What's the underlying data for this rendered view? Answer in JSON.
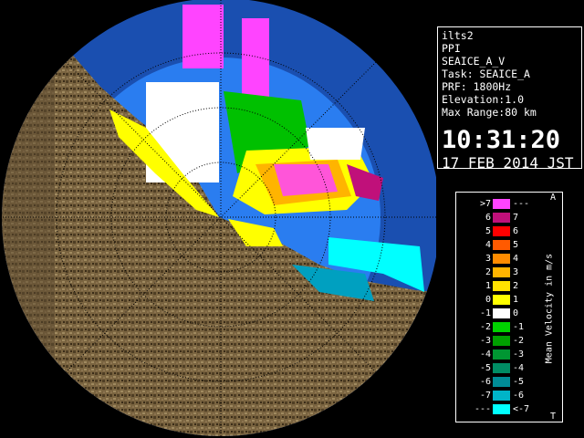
{
  "info": {
    "station": "ilts2",
    "product": "PPI",
    "task_name": "SEAICE_A_V",
    "task": "Task: SEAICE_A",
    "prf": "PRF: 1800Hz",
    "elevation": "Elevation:1.0",
    "max_range": "Max Range:80 km",
    "time": "10:31:20",
    "date": "17 FEB 2014 JST"
  },
  "legend": {
    "title": "Mean Velocity in m/s",
    "top_marker": "A",
    "bottom_marker": "T",
    "rows": [
      {
        "left": ">7",
        "right": "---",
        "color": "#ff44ff"
      },
      {
        "left": "6",
        "right": "7",
        "color": "#c0107a"
      },
      {
        "left": "5",
        "right": "6",
        "color": "#ff0000"
      },
      {
        "left": "4",
        "right": "5",
        "color": "#ff5a00"
      },
      {
        "left": "3",
        "right": "4",
        "color": "#ff8c00"
      },
      {
        "left": "2",
        "right": "3",
        "color": "#ffb400"
      },
      {
        "left": "1",
        "right": "2",
        "color": "#ffe100"
      },
      {
        "left": "0",
        "right": "1",
        "color": "#ffff00"
      },
      {
        "left": "-1",
        "right": "0",
        "color": "#ffffff"
      },
      {
        "left": "-2",
        "right": "-1",
        "color": "#00d200"
      },
      {
        "left": "-3",
        "right": "-2",
        "color": "#00a000"
      },
      {
        "left": "-4",
        "right": "-3",
        "color": "#009632"
      },
      {
        "left": "-5",
        "right": "-4",
        "color": "#008c64"
      },
      {
        "left": "-6",
        "right": "-5",
        "color": "#008c96"
      },
      {
        "left": "-7",
        "right": "-6",
        "color": "#00b4c8"
      },
      {
        "left": "---",
        "right": "<-7",
        "color": "#00ffff"
      }
    ]
  },
  "map": {
    "ocean_color": "#2a7df0",
    "outer_color": "#1a4fb0",
    "land_color": "#7a6440"
  }
}
